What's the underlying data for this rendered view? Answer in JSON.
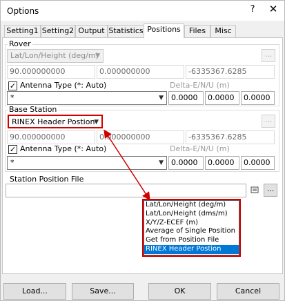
{
  "window": {
    "title": "Options",
    "help_label": "?",
    "close_label": "✕"
  },
  "tabs": [
    {
      "label": "Setting1"
    },
    {
      "label": "Setting2"
    },
    {
      "label": "Output"
    },
    {
      "label": "Statistics"
    },
    {
      "label": "Positions"
    },
    {
      "label": "Files"
    },
    {
      "label": "Misc"
    }
  ],
  "active_tab": "Positions",
  "rover": {
    "group_label": "Rover",
    "format_value": "Lat/Lon/Height (deg/m)",
    "browse_label": "...",
    "pos": [
      "90.000000000",
      "0.000000000",
      "-6335367.6285"
    ],
    "antenna_label": "Antenna Type (*: Auto)",
    "antenna_checked": true,
    "antenna_value": "*",
    "delta_label": "Delta-E/N/U (m)",
    "delta": [
      "0.0000",
      "0.0000",
      "0.0000"
    ]
  },
  "base": {
    "group_label": "Base Station",
    "format_value": "RINEX Header Postion",
    "browse_label": "...",
    "pos": [
      "90.000000000",
      "0.000000000",
      "-6335367.6285"
    ],
    "antenna_label": "Antenna Type (*: Auto)",
    "antenna_checked": true,
    "antenna_value": "*",
    "delta_label": "Delta-E/N/U (m)",
    "delta": [
      "0.0000",
      "0.0000",
      "0.0000"
    ]
  },
  "station_file": {
    "label": "Station Position File",
    "value": "",
    "view_icon": "file-view-icon",
    "browse_label": "..."
  },
  "dropdown": {
    "options": [
      "Lat/Lon/Height (deg/m)",
      "Lat/Lon/Height (dms/m)",
      "X/Y/Z-ECEF (m)",
      "Average of Single Position",
      "Get from Position File",
      "RINEX Header Postion"
    ],
    "selected_index": 5
  },
  "annotation_color": "#d10000",
  "buttons": {
    "load": "Load...",
    "save": "Save...",
    "ok": "OK",
    "cancel": "Cancel"
  }
}
